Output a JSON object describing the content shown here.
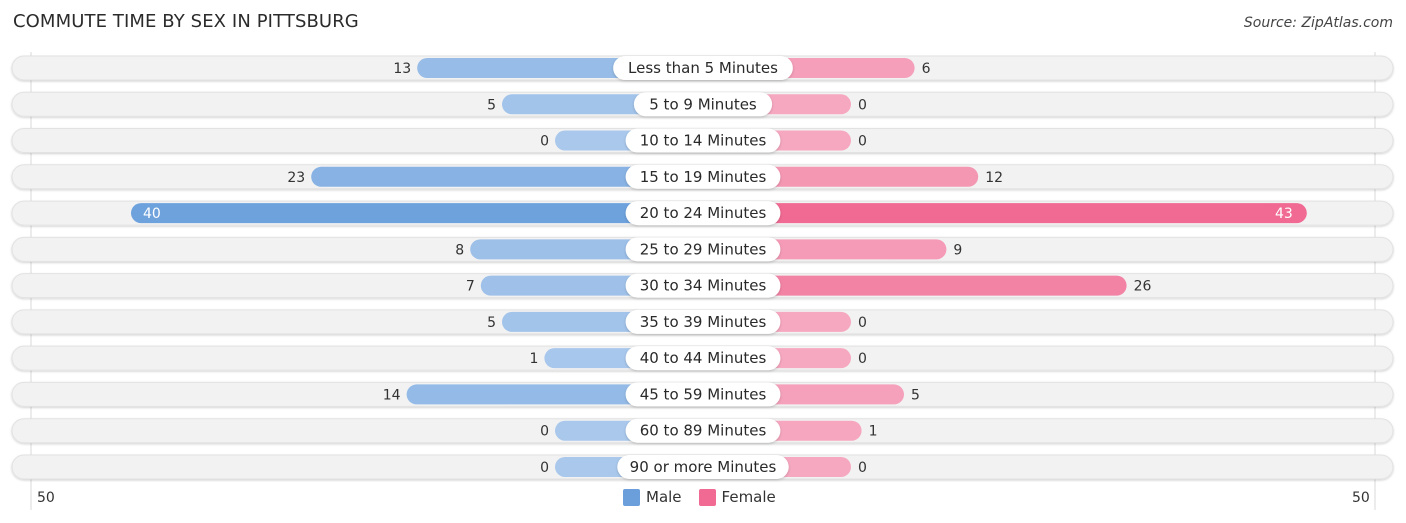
{
  "title": "COMMUTE TIME BY SEX IN PITTSBURG",
  "source": "Source: ZipAtlas.com",
  "colors": {
    "male": "#6a9fdc",
    "male_light": "#a9c8ec",
    "female": "#f06a93",
    "female_light": "#f6a8c0",
    "track": "#f2f2f2",
    "label_bg": "#ffffff"
  },
  "legend": [
    {
      "name": "Male",
      "color": "#6a9fdc"
    },
    {
      "name": "Female",
      "color": "#f06a93"
    }
  ],
  "axis": {
    "left_label": "50",
    "right_label": "50"
  },
  "chart_data": {
    "type": "bar",
    "orientation": "horizontal-diverging",
    "title": "COMMUTE TIME BY SEX IN PITTSBURG",
    "categories": [
      "Less than 5 Minutes",
      "5 to 9 Minutes",
      "10 to 14 Minutes",
      "15 to 19 Minutes",
      "20 to 24 Minutes",
      "25 to 29 Minutes",
      "30 to 34 Minutes",
      "35 to 39 Minutes",
      "40 to 44 Minutes",
      "45 to 59 Minutes",
      "60 to 89 Minutes",
      "90 or more Minutes"
    ],
    "series": [
      {
        "name": "Male",
        "values": [
          13,
          5,
          0,
          23,
          40,
          8,
          7,
          5,
          1,
          14,
          0,
          0
        ]
      },
      {
        "name": "Female",
        "values": [
          6,
          0,
          0,
          12,
          43,
          9,
          26,
          0,
          0,
          5,
          1,
          0
        ]
      }
    ],
    "xlim": [
      50,
      50
    ],
    "xlabel": "",
    "ylabel": "",
    "legend_position": "bottom-center",
    "grid": false
  }
}
